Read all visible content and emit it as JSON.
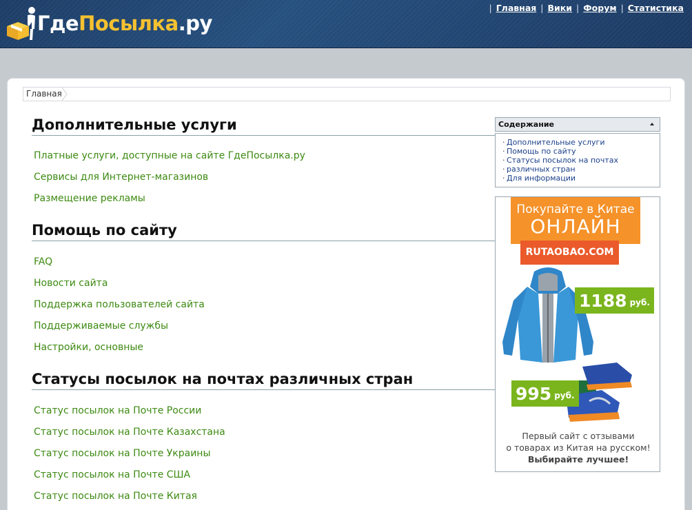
{
  "site": {
    "logo_part1": "Где",
    "logo_part2": "Посылка",
    "logo_part3": ".ру"
  },
  "topnav": {
    "separator": "|",
    "items": [
      "Главная",
      "Вики",
      "Форум",
      "Статистика"
    ]
  },
  "breadcrumb": {
    "home": "Главная"
  },
  "sections": [
    {
      "title": "Дополнительные услуги",
      "links": [
        "Платные услуги, доступные на сайте ГдеПосылка.ру",
        "Сервисы для Интернет-магазинов",
        "Размещение рекламы"
      ]
    },
    {
      "title": "Помощь по сайту",
      "links": [
        "FAQ",
        "Новости сайта",
        "Поддержка пользователей сайта",
        "Поддерживаемые службы",
        "Настройки, основные"
      ]
    },
    {
      "title": "Статусы посылок на почтах различных стран",
      "links": [
        "Статус посылок на Почте России",
        "Статус посылок на Почте Казахстана",
        "Статус посылок на Почте Украины",
        "Статус посылок на Почте США",
        "Статус посылок на Почте Китая"
      ]
    }
  ],
  "toc": {
    "title": "Содержание",
    "items": [
      "Дополнительные услуги",
      "Помощь по сайту",
      "Статусы посылок на почтах",
      "различных стран",
      "Для информации"
    ]
  },
  "ad": {
    "line1": "Покупайте в Китае",
    "line2": "ОНЛАЙН",
    "site": "RUTAOBAO.COM",
    "price1": "1188",
    "price2": "995",
    "currency": "руб.",
    "text1": "Первый сайт с отзывами",
    "text2": "о товарах из Китая на русском!",
    "text3": "Выбирайте лучшее!",
    "colors": {
      "orange": "#f5922a",
      "red": "#ea5a2a",
      "green": "#7ab51d"
    }
  },
  "colors": {
    "header": "#1d3d66",
    "link": "#3d8a12",
    "toc_link": "#1a3f8a",
    "logo_yellow": "#f5c130"
  }
}
